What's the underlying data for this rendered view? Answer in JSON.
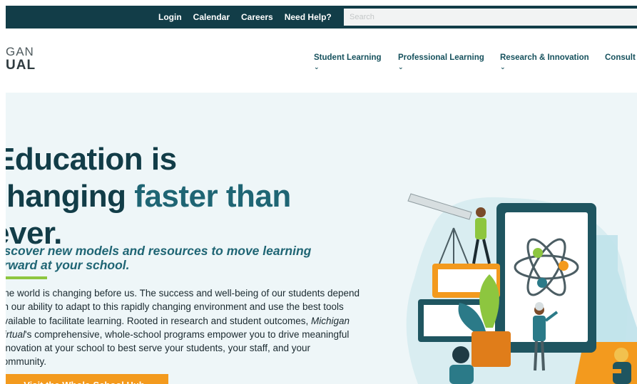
{
  "topbar": {
    "links": [
      "Login",
      "Calendar",
      "Careers",
      "Need Help?"
    ],
    "search_placeholder": "Search"
  },
  "logo": {
    "line1": "GAN",
    "line2": "UAL"
  },
  "nav": {
    "items": [
      "Student Learning",
      "Professional Learning",
      "Research & Innovation",
      "Consult"
    ]
  },
  "hero": {
    "headline_line1": "Education is",
    "headline_line2a": "changing",
    "headline_line2b": "faster than",
    "headline_line3": "ever.",
    "subhead": "Discover new models and resources to move learning forward at your school.",
    "body_part1": "The world is changing before us. The success and well-being of our students depend on our ability to adapt to this rapidly changing environment and use the best tools available to facilitate learning. Rooted in research and student outcomes, ",
    "body_emphasis": "Michigan Virtual",
    "body_part2": "'s comprehensive, whole-school programs empower you to drive meaningful innovation at your school to best serve your students, your staff, and your community.",
    "cta_label": "Visit the Whole-School Hub"
  },
  "colors": {
    "topbar_bg": "#123d48",
    "nav_text": "#16515d",
    "headline": "#123d48",
    "accent_teal": "#1f6574",
    "divider_green": "#8dc63f",
    "cta_orange": "#f39a1e",
    "hero_bg": "#eef6f8"
  },
  "icons": [
    "chevron-down-icon"
  ]
}
